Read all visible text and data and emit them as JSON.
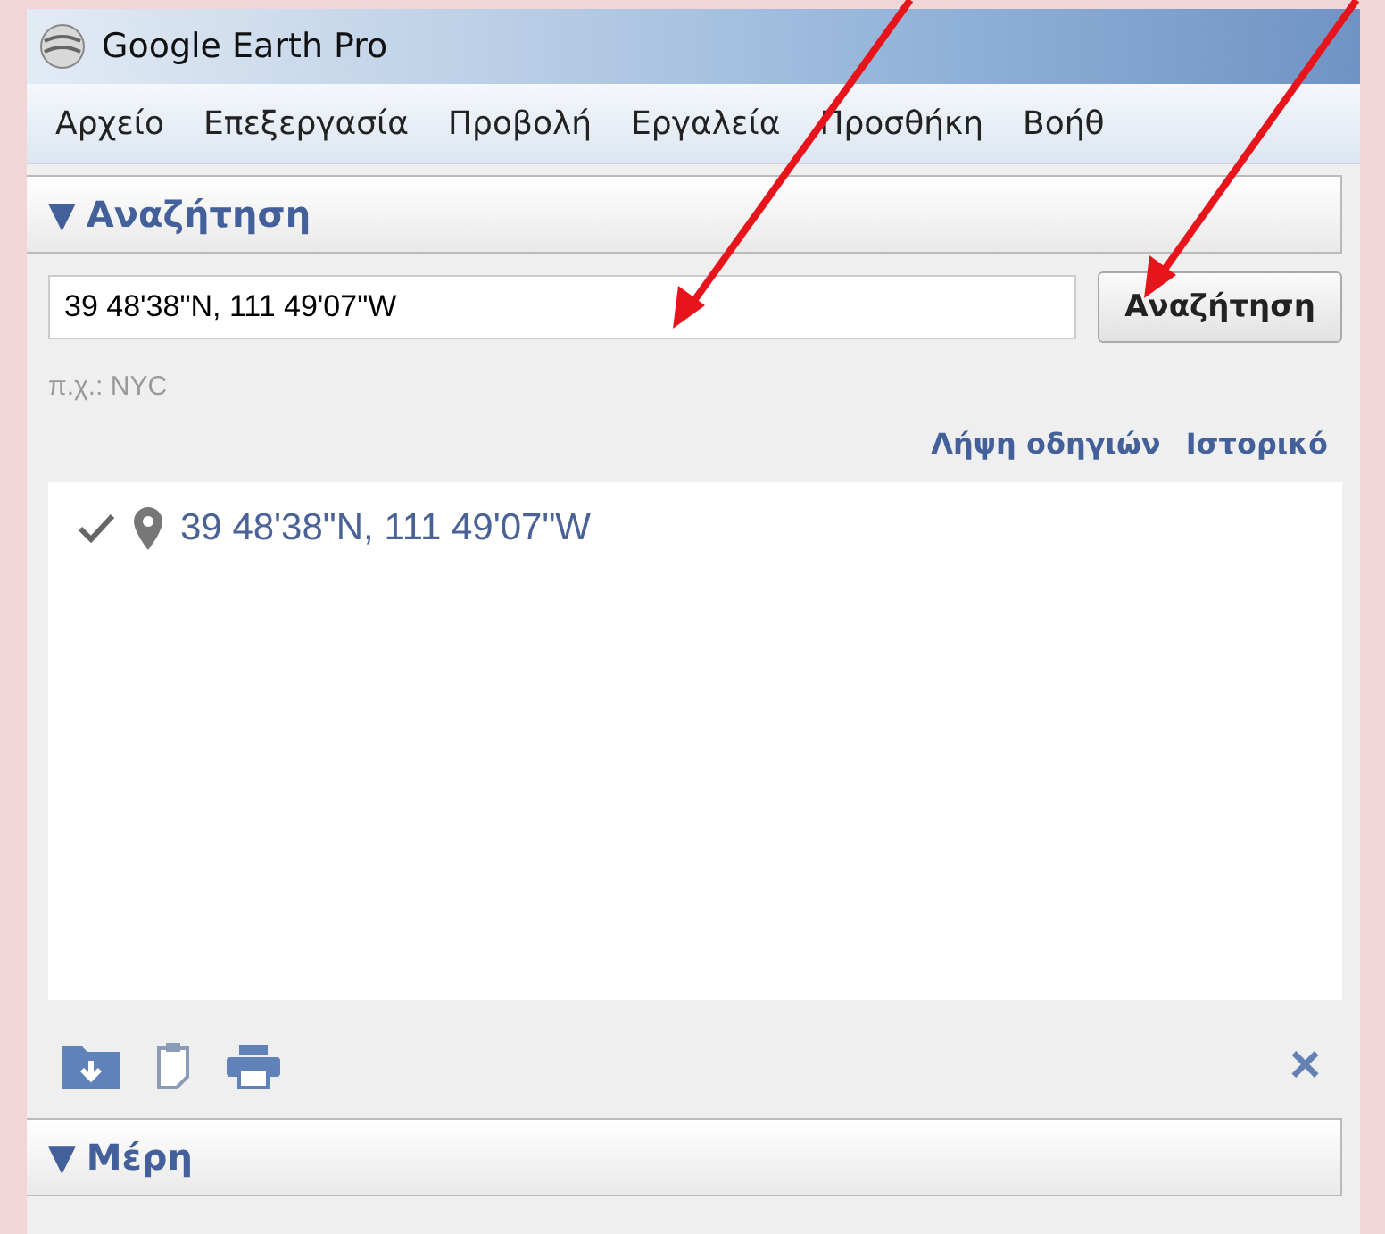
{
  "window": {
    "title": "Google Earth Pro"
  },
  "menu": [
    "Αρχείο",
    "Επεξεργασία",
    "Προβολή",
    "Εργαλεία",
    "Προσθήκη",
    "Βοήθ"
  ],
  "search_panel": {
    "toggle": "▼",
    "title": "Αναζήτηση",
    "field": {
      "value": "39 48'38\"N, 111 49'07\"W"
    },
    "button": "Αναζήτηση",
    "hint": "π.χ.: NYC",
    "links": [
      "Λήψη οδηγιών",
      "Ιστορικό"
    ],
    "results": [
      {
        "text": "39 48'38\"N, 111 49'07\"W"
      }
    ],
    "close": "×"
  },
  "places_panel": {
    "toggle": "▼",
    "title": "Μέρη"
  }
}
